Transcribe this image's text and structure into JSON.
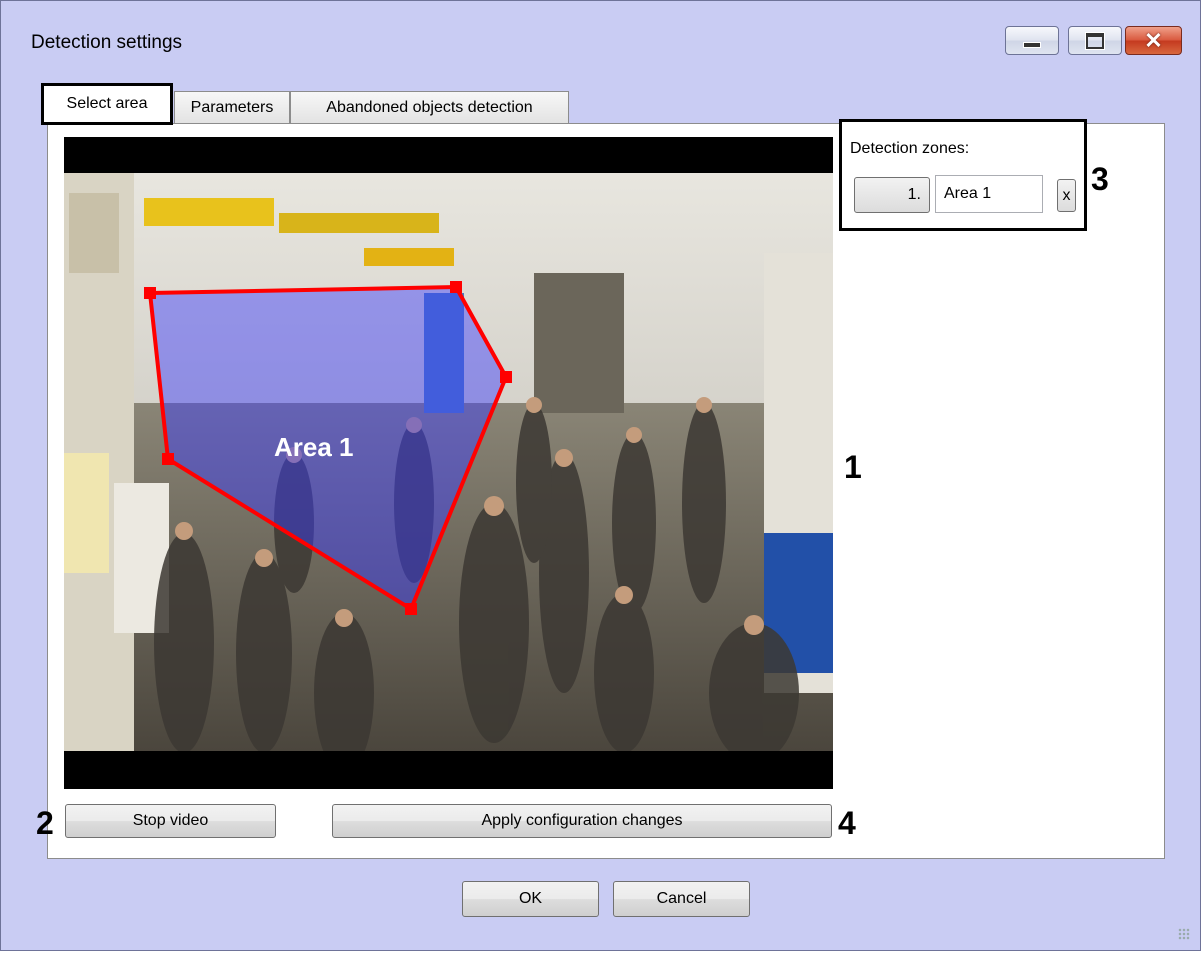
{
  "window": {
    "title": "Detection settings"
  },
  "window_controls": {
    "minimize": "minimize-icon",
    "maximize": "maximize-icon",
    "close": "close-icon"
  },
  "tabs": [
    {
      "label": "Select area",
      "selected": true
    },
    {
      "label": "Parameters",
      "selected": false
    },
    {
      "label": "Abandoned objects detection",
      "selected": false
    }
  ],
  "video": {
    "zone_label": "Area 1"
  },
  "zones": {
    "title": "Detection zones:",
    "items": [
      {
        "number": "1.",
        "name": "Area 1",
        "delete_label": "x"
      }
    ]
  },
  "annotations": {
    "video": "1",
    "stop": "2",
    "zones": "3",
    "apply": "4"
  },
  "buttons": {
    "stop_video": "Stop video",
    "apply": "Apply configuration changes",
    "ok": "OK",
    "cancel": "Cancel"
  },
  "colors": {
    "window_bg": "#c9ccf3",
    "zone_outline": "#ff0000",
    "zone_fill": "#3a3aff"
  }
}
